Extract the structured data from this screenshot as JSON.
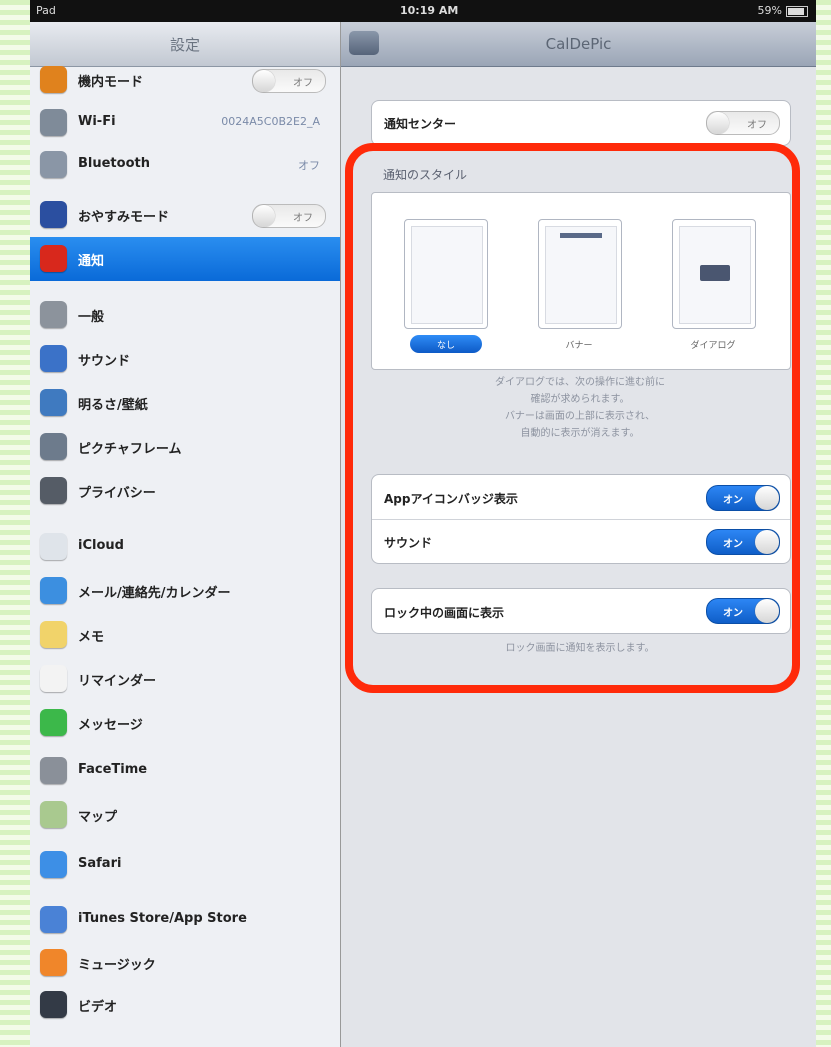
{
  "status": {
    "left": "Pad",
    "time": "10:19 AM",
    "battery": "59%"
  },
  "master": {
    "title": "設定",
    "items": [
      {
        "label": "機内モード",
        "icon": "airplane-icon",
        "color": "#e0821d",
        "switch": "オフ"
      },
      {
        "label": "Wi-Fi",
        "icon": "wifi-icon",
        "color": "#7f8b99",
        "value": "0024A5C0B2E2_A"
      },
      {
        "label": "Bluetooth",
        "icon": "bluetooth-icon",
        "color": "#8a96a6",
        "value": "オフ"
      },
      {
        "label": "おやすみモード",
        "icon": "moon-icon",
        "color": "#2b4fa0",
        "switch": "オフ"
      },
      {
        "label": "通知",
        "icon": "notification-icon",
        "color": "#d8281c"
      },
      {
        "label": "一般",
        "icon": "gear-icon",
        "color": "#8c939c"
      },
      {
        "label": "サウンド",
        "icon": "sound-icon",
        "color": "#3b72c8"
      },
      {
        "label": "明るさ/壁紙",
        "icon": "brightness-icon",
        "color": "#3f7ac0"
      },
      {
        "label": "ピクチャフレーム",
        "icon": "picture-frame-icon",
        "color": "#6d7b8c"
      },
      {
        "label": "プライバシー",
        "icon": "privacy-icon",
        "color": "#555c66"
      },
      {
        "label": "iCloud",
        "icon": "cloud-icon",
        "color": "#dfe4ea"
      },
      {
        "label": "メール/連絡先/カレンダー",
        "icon": "mail-icon",
        "color": "#3c8fe0"
      },
      {
        "label": "メモ",
        "icon": "notes-icon",
        "color": "#f1d36a"
      },
      {
        "label": "リマインダー",
        "icon": "reminders-icon",
        "color": "#f3f3f3"
      },
      {
        "label": "メッセージ",
        "icon": "messages-icon",
        "color": "#3cb84a"
      },
      {
        "label": "FaceTime",
        "icon": "facetime-icon",
        "color": "#8a9099"
      },
      {
        "label": "マップ",
        "icon": "maps-icon",
        "color": "#a9c98f"
      },
      {
        "label": "Safari",
        "icon": "safari-icon",
        "color": "#3d8fe6"
      },
      {
        "label": "iTunes Store/App Store",
        "icon": "itunes-icon",
        "color": "#4a82d6"
      },
      {
        "label": "ミュージック",
        "icon": "music-icon",
        "color": "#f0862a"
      },
      {
        "label": "ビデオ",
        "icon": "video-icon",
        "color": "#333a46"
      }
    ]
  },
  "detail": {
    "back": "",
    "title": "CalDePic",
    "notification_center": {
      "label": "通知センター",
      "switch": "オフ"
    },
    "style_header": "通知のスタイル",
    "styles": [
      {
        "caption": "なし",
        "selected": true
      },
      {
        "caption": "バナー",
        "selected": false
      },
      {
        "caption": "ダイアログ",
        "selected": false
      }
    ],
    "style_note": [
      "ダイアログでは、次の操作に進む前に",
      "確認が求められます。",
      "バナーは画面の上部に表示され、",
      "自動的に表示が消えます。"
    ],
    "badge": {
      "label": "Appアイコンバッジ表示",
      "switch": "オン"
    },
    "sound": {
      "label": "サウンド",
      "switch": "オン"
    },
    "lock": {
      "label": "ロック中の画面に表示",
      "switch": "オン"
    },
    "lock_note": "ロック画面に通知を表示します。"
  },
  "colors": {
    "highlight": "#ff2a0a",
    "accent": "#0a6ad8"
  }
}
